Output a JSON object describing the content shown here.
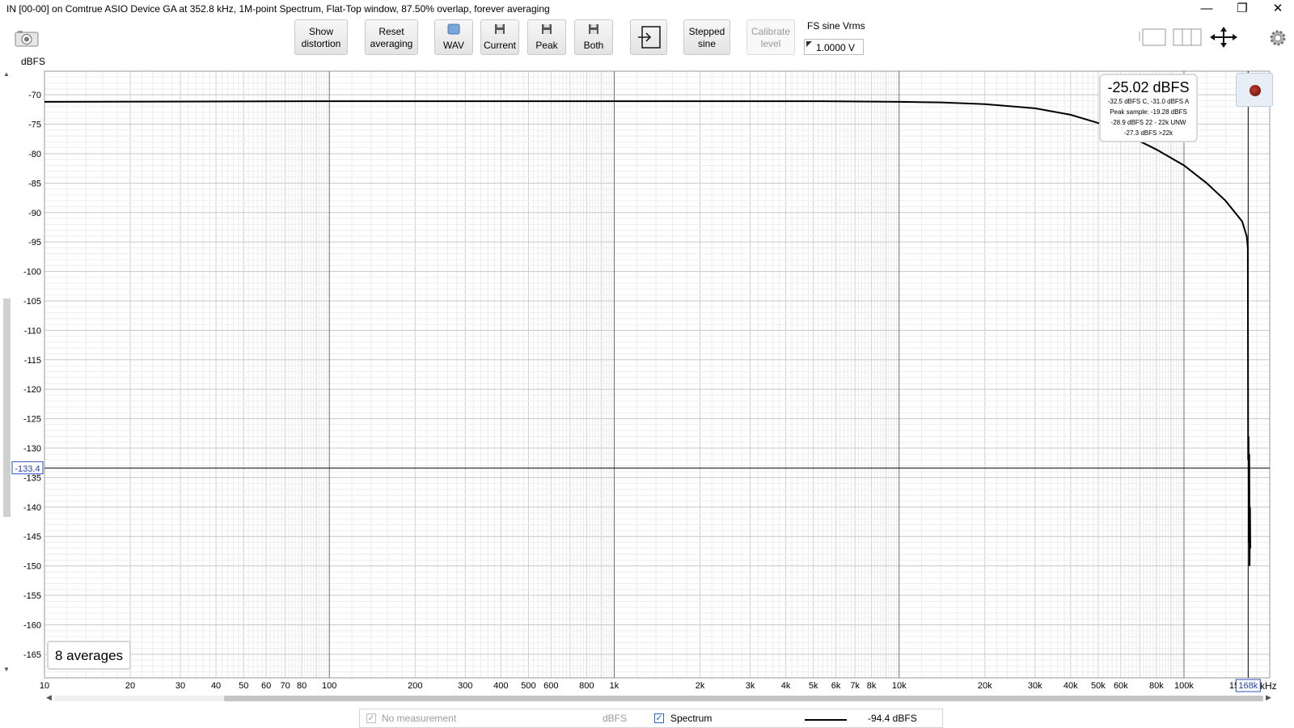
{
  "window": {
    "title": "IN [00-00] on Comtrue ASIO Device GA at 352.8 kHz, 1M-point Spectrum, Flat-Top window, 87.50% overlap, forever averaging",
    "minimize": "—",
    "restore": "❐",
    "close": "✕"
  },
  "toolbar": {
    "show_distortion": [
      "Show",
      "distortion"
    ],
    "reset_averaging": [
      "Reset",
      "averaging"
    ],
    "wav": "WAV",
    "current": "Current",
    "peak": "Peak",
    "both": "Both",
    "stepped_sine": [
      "Stepped",
      "sine"
    ],
    "calibrate_level": [
      "Calibrate",
      "level"
    ],
    "fs_sine_label": "FS sine Vrms",
    "fs_sine_value": "1.0000 V",
    "icons": [
      "camera-icon",
      "save-icon",
      "export-arrow-icon",
      "single-view-icon",
      "split-view-icon",
      "move-arrows-icon",
      "gear-icon"
    ]
  },
  "plot": {
    "y_unit": "dBFS",
    "x_unit": "kHz",
    "cursor_y_label": "-133.4",
    "cursor_x_label": "168k",
    "averages": "8 averages",
    "readout": {
      "main": "-25.02 dBFS",
      "lines": [
        "-32.5 dBFS C, -31.0 dBFS A",
        "Peak sample: -19.28 dBFS",
        "-28.9 dBFS 22 - 22k UNW",
        "-27.3 dBFS >22k"
      ]
    }
  },
  "legend": {
    "no_measurement": "No measurement",
    "unit": "dBFS",
    "spectrum": "Spectrum",
    "spectrum_value": "-94.4 dBFS"
  },
  "chart_data": {
    "type": "line",
    "title": "",
    "xlabel": "",
    "ylabel": "dBFS",
    "x_scale": "log",
    "xlim": [
      10,
      200000
    ],
    "ylim": [
      -169,
      -66
    ],
    "x_ticks": [
      10,
      20,
      30,
      40,
      50,
      60,
      70,
      80,
      100,
      200,
      300,
      400,
      500,
      600,
      800,
      1000,
      2000,
      3000,
      4000,
      5000,
      6000,
      7000,
      8000,
      10000,
      20000,
      30000,
      40000,
      50000,
      60000,
      80000,
      100000,
      150000
    ],
    "x_tick_labels": [
      "10",
      "20",
      "30",
      "40",
      "50",
      "60",
      "70",
      "80",
      "100",
      "200",
      "300",
      "400",
      "500",
      "600",
      "800",
      "1k",
      "2k",
      "3k",
      "4k",
      "5k",
      "6k",
      "7k",
      "8k",
      "10k",
      "20k",
      "30k",
      "40k",
      "50k",
      "60k",
      "80k",
      "100k",
      "15"
    ],
    "y_ticks": [
      -70,
      -75,
      -80,
      -85,
      -90,
      -95,
      -100,
      -105,
      -110,
      -115,
      -120,
      -125,
      -130,
      -135,
      -140,
      -145,
      -150,
      -155,
      -160,
      -165
    ],
    "grid": true,
    "cursor": {
      "x": 168000,
      "y": -133.4
    },
    "series": [
      {
        "name": "Spectrum",
        "color": "#000000",
        "x": [
          10,
          100,
          1000,
          5000,
          10000,
          14000,
          20000,
          30000,
          40000,
          50000,
          60000,
          80000,
          100000,
          120000,
          140000,
          160000,
          166000,
          167500,
          168000,
          168500,
          169000,
          169500,
          170000,
          170500,
          171000
        ],
        "y": [
          -71.2,
          -71.1,
          -71.1,
          -71.1,
          -71.2,
          -71.3,
          -71.6,
          -72.3,
          -73.4,
          -74.8,
          -76.3,
          -79.3,
          -82.0,
          -85.0,
          -88.0,
          -91.5,
          -94.0,
          -96.0,
          -132.0,
          -128.0,
          -146.0,
          -131.0,
          -150.0,
          -140.0,
          -147.0
        ]
      }
    ]
  }
}
